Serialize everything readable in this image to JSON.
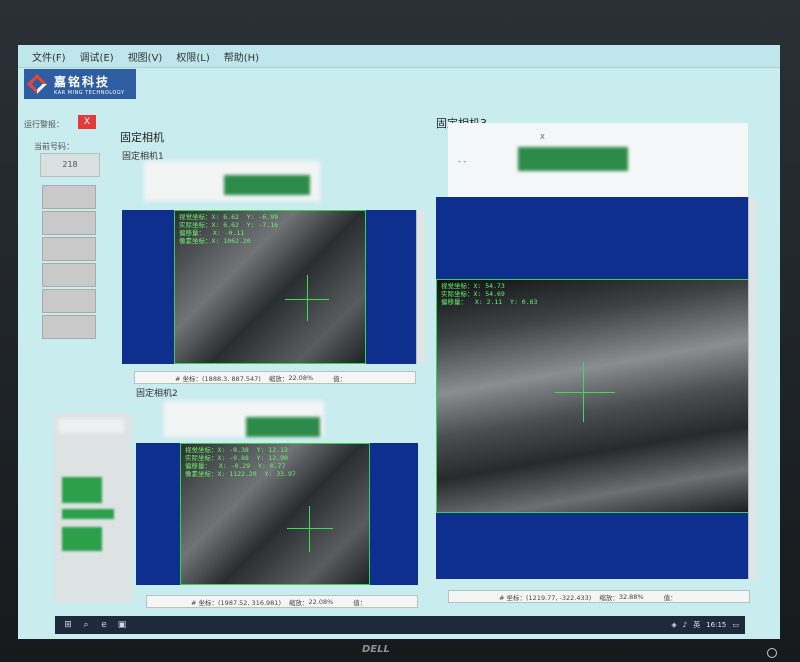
{
  "menu": [
    "文件(F)",
    "调试(E)",
    "视图(V)",
    "权限(L)",
    "帮助(H)"
  ],
  "logo": {
    "cn": "嘉铭科技",
    "en": "KAR MING TECHNOLOGY"
  },
  "left": {
    "alarm_label": "运行警报：",
    "alarm_button": "X",
    "count_label": "当前号码：",
    "count_value": "218"
  },
  "groups": {
    "fixed_cams": "固定相机",
    "cam3_title": "固定相机3"
  },
  "cam1": {
    "label": "固定相机1",
    "overlay": "视觉坐标：X: 6.62  Y: -6.99\n实际坐标：X: 6.62  Y: -7.16\n偏移量：  X: -0.11\n像素坐标：X: 1062.20",
    "status_pos": "# 坐标：(1888.3, 887.547)",
    "status_zoom_label": "缩放：",
    "status_zoom": "22.08%",
    "status_extra": "值："
  },
  "cam2": {
    "label": "固定相机2",
    "overlay": "视觉坐标：X: -0.38  Y: 12.13\n实际坐标：X: -0.88  Y: 12.90\n偏移量：  X: -0.29  Y: 0.77\n像素坐标：X: 1122.20  Y: 33.97",
    "status_pos": "# 坐标：(1987.52, 316.981)",
    "status_zoom_label": "缩放：",
    "status_zoom": "22.08%",
    "status_extra": "值："
  },
  "cam3": {
    "header_x": "X",
    "header_dash": "- -",
    "overlay": "视觉坐标：X: 54.73\n实际坐标：X: 54.69\n偏移量：  X: 2.11  Y: 0.63",
    "status_pos": "# 坐标：(1219.77, -322.433)",
    "status_zoom_label": "缩放：",
    "status_zoom": "32.88%",
    "status_extra": "值："
  },
  "taskbar": {
    "lang": "英",
    "time": "16:15"
  },
  "brand": "DELL",
  "colors": {
    "screen_bg": "#c9ecef",
    "view_bg": "#0e2f8e",
    "crosshair": "#39e04c",
    "alarm": "#e23b3b"
  },
  "icons": [
    "windows-icon",
    "search-icon",
    "edge-icon",
    "app-icon",
    "power-icon"
  ]
}
